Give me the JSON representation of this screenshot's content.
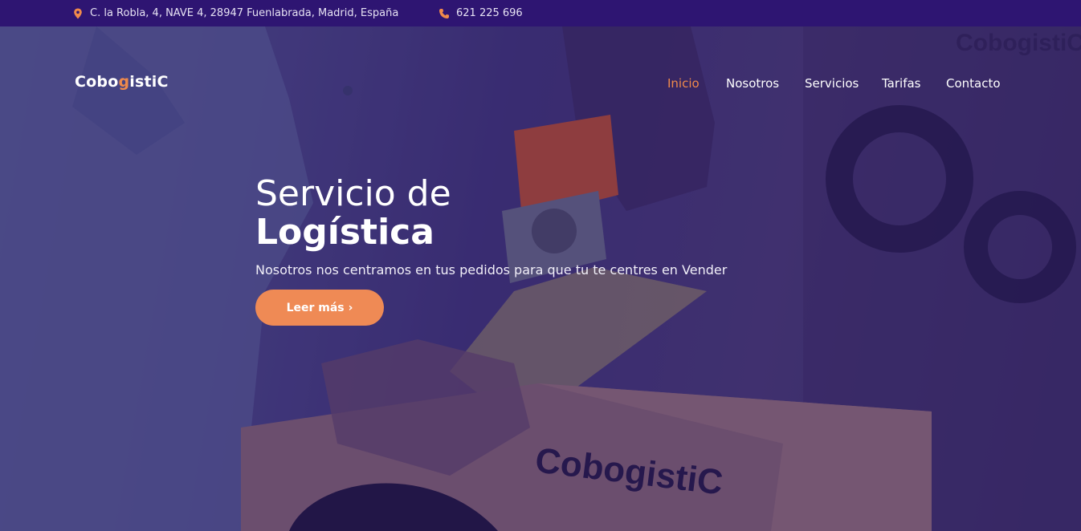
{
  "topbar": {
    "address": "C. la Robla, 4, NAVE 4, 28947 Fuenlabrada, Madrid, España",
    "phone": "621 225 696"
  },
  "brand": {
    "logo_prefix": "Cobo",
    "logo_mark": "g",
    "logo_suffix": "istiC",
    "box_text": "CobogistiC"
  },
  "nav": {
    "items": [
      {
        "label": "Inicio",
        "active": true
      },
      {
        "label": "Nosotros",
        "active": false
      },
      {
        "label": "Servicios",
        "active": false
      },
      {
        "label": "Tarifas",
        "active": false
      },
      {
        "label": "Contacto",
        "active": false
      }
    ]
  },
  "hero": {
    "title_line1": "Servicio de",
    "title_line2": "Logística",
    "subtitle": "Nosotros nos centramos en tus pedidos para que tu te centres en Vender",
    "cta_label": "Leer más",
    "cta_icon": "chevron-right-icon"
  },
  "colors": {
    "topbar": "#2e1572",
    "accent": "#f08a4b",
    "button": "#ef8a55",
    "overlay": "#3f3677"
  }
}
